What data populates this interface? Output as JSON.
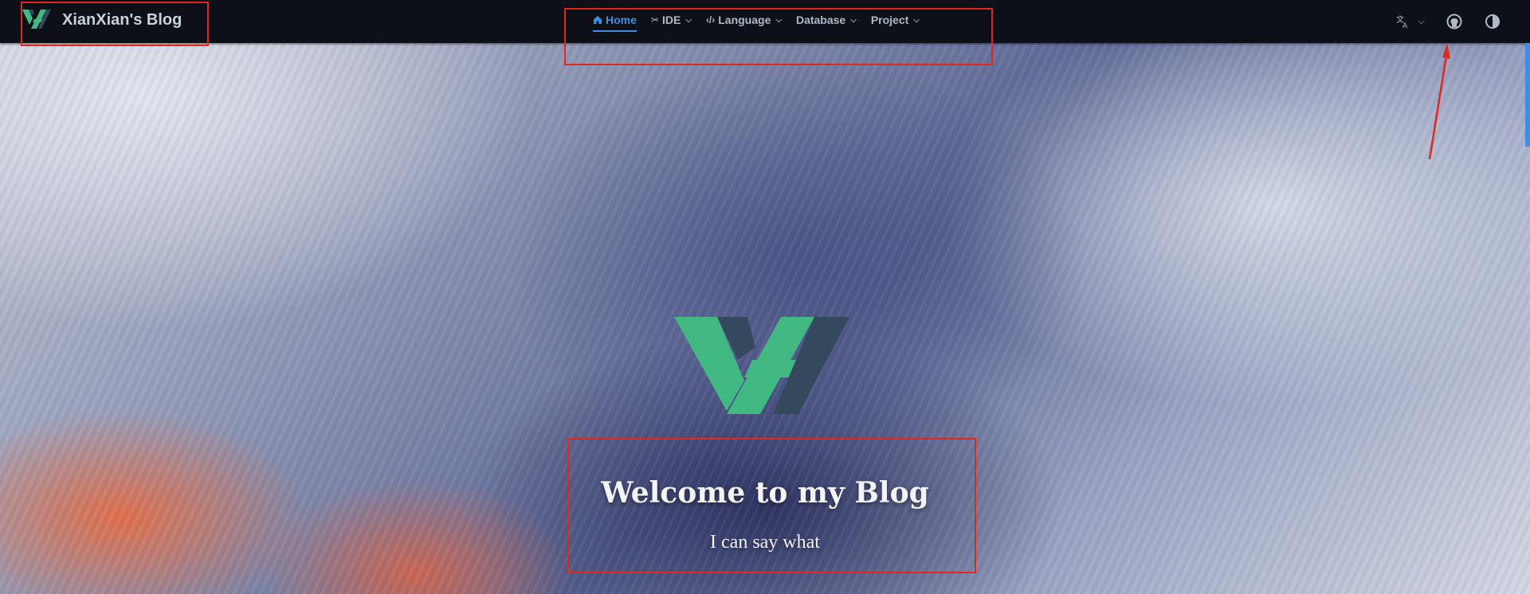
{
  "brand": {
    "title": "XianXian's Blog"
  },
  "nav": {
    "items": [
      {
        "label": "Home",
        "icon": "home-icon",
        "dropdown": false,
        "active": true
      },
      {
        "label": "IDE",
        "icon": "tools-icon",
        "dropdown": true,
        "active": false
      },
      {
        "label": "Language",
        "icon": "code-icon",
        "dropdown": true,
        "active": false
      },
      {
        "label": "Database",
        "icon": "",
        "dropdown": true,
        "active": false
      },
      {
        "label": "Project",
        "icon": "",
        "dropdown": true,
        "active": false
      }
    ]
  },
  "toolbar": {
    "language_icon": "translate-icon",
    "github_icon": "github-icon",
    "theme_icon": "contrast-icon"
  },
  "hero": {
    "title": "Welcome to my Blog",
    "tagline": "I can say what"
  },
  "colors": {
    "navbar_bg": "#0d1117",
    "accent": "#3e8ee6",
    "logo_green": "#42b883",
    "logo_dark": "#35495e",
    "annotation_red": "#e0281f"
  }
}
